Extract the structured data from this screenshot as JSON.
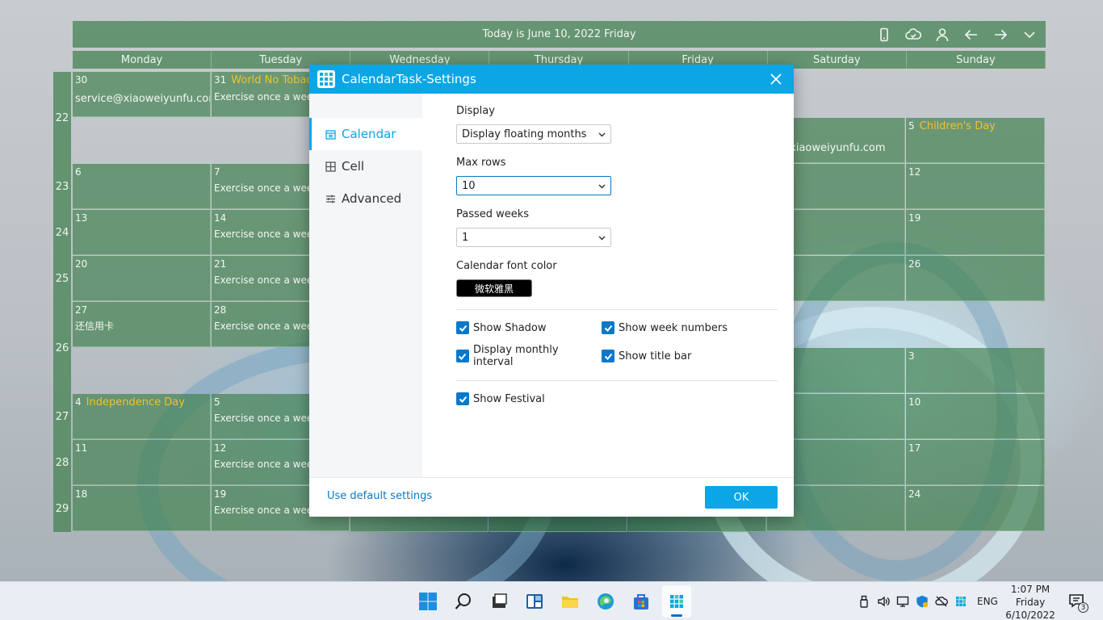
{
  "calendar": {
    "title": "Today is June 10, 2022 Friday",
    "days": [
      "Monday",
      "Tuesday",
      "Wednesday",
      "Thursday",
      "Friday",
      "Saturday",
      "Sunday"
    ],
    "week_numbers": [
      "22",
      "23",
      "24",
      "25",
      "26",
      "27",
      "28",
      "29"
    ],
    "cells": {
      "mon_may30": {
        "day": "30",
        "email": "service@xiaoweiyunfu.com"
      },
      "tue_may31": {
        "day": "31",
        "festival": "World No Tobac",
        "task": "Exercise once a week"
      },
      "sat_jun4_email": "ce@xiaoweiyunfu.com",
      "sun_jun5": {
        "day": "5",
        "festival": "Children's Day"
      },
      "mon_jun6": {
        "day": "6"
      },
      "tue_jun7": {
        "day": "7",
        "task": "Exercise once a week"
      },
      "sun_jun12": {
        "day": "12"
      },
      "mon_jun13": {
        "day": "13"
      },
      "tue_jun14": {
        "day": "14",
        "task": "Exercise once a week"
      },
      "sun_jun19": {
        "day": "19"
      },
      "mon_jun20": {
        "day": "20"
      },
      "tue_jun21": {
        "day": "21",
        "task": "Exercise once a week"
      },
      "sun_jun26": {
        "day": "26"
      },
      "mon_jun27": {
        "day": "27",
        "task": "还信用卡"
      },
      "tue_jun28": {
        "day": "28",
        "task": "Exercise once a week"
      },
      "sun_jul3": {
        "day": "3"
      },
      "mon_jul4": {
        "day": "4",
        "festival": "Independence Day"
      },
      "tue_jul5": {
        "day": "5",
        "task": "Exercise once a week"
      },
      "sun_jul10": {
        "day": "10"
      },
      "mon_jul11": {
        "day": "11"
      },
      "tue_jul12": {
        "day": "12",
        "task": "Exercise once a week"
      },
      "sun_jul17": {
        "day": "17"
      },
      "mon_jul18": {
        "day": "18"
      },
      "tue_jul19": {
        "day": "19",
        "task": "Exercise once a week"
      },
      "sun_jul24": {
        "day": "24"
      }
    }
  },
  "dialog": {
    "title": "CalendarTask-Settings",
    "nav": {
      "calendar": "Calendar",
      "cell": "Cell",
      "advanced": "Advanced"
    },
    "display_label": "Display",
    "display_value": "Display floating months",
    "max_rows_label": "Max rows",
    "max_rows_value": "10",
    "passed_weeks_label": "Passed weeks",
    "passed_weeks_value": "1",
    "font_color_label": "Calendar font color",
    "font_color_button": "微软雅黑",
    "checks": {
      "show_shadow": "Show Shadow",
      "show_week_numbers": "Show week numbers",
      "display_monthly_interval": "Display monthly interval",
      "show_title_bar": "Show title bar",
      "show_festival": "Show Festival"
    },
    "default_link": "Use default settings",
    "ok_label": "OK"
  },
  "taskbar": {
    "language": "ENG",
    "time": "1:07 PM",
    "day": "Friday",
    "date": "6/10/2022",
    "notification_count": "3"
  },
  "colors": {
    "accent": "#0aa6e6",
    "calendar_green": "#40804e",
    "festival_text": "#f2c12e"
  }
}
